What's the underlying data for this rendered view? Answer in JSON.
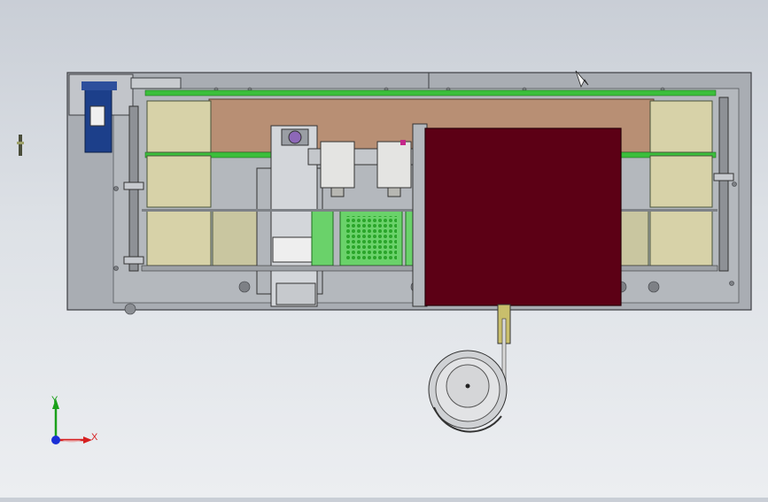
{
  "triad": {
    "x_label": "X",
    "y_label": "Y",
    "x_color": "#d62020",
    "y_color": "#1aa01a",
    "z_color": "#1a2fd6"
  },
  "colors": {
    "base_plate": "#a9adb3",
    "tray_panel": "#b88f74",
    "cover_plate": "#5c0015",
    "motor": "#1c3f8a",
    "tray_green": "#3bbf3b",
    "pocket": "#d7d2a8"
  },
  "icons": [
    "axis-triad-icon",
    "motor-icon",
    "vibratory-bowl-icon",
    "cursor-icon"
  ]
}
